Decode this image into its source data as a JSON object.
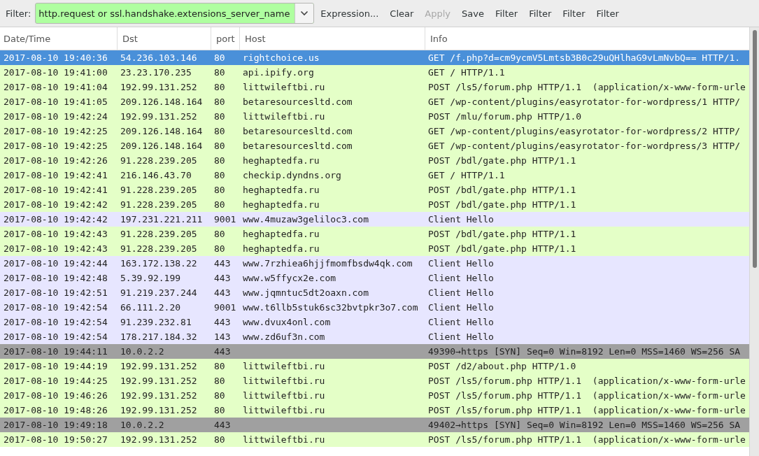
{
  "toolbar": {
    "filter_label": "Filter:",
    "filter_value": "http.request or ssl.handshake.extensions_server_name",
    "buttons": [
      {
        "label": "Expression...",
        "disabled": false
      },
      {
        "label": "Clear",
        "disabled": false
      },
      {
        "label": "Apply",
        "disabled": true
      },
      {
        "label": "Save",
        "disabled": false
      },
      {
        "label": "Filter",
        "disabled": false
      },
      {
        "label": "Filter",
        "disabled": false
      },
      {
        "label": "Filter",
        "disabled": false
      },
      {
        "label": "Filter",
        "disabled": false
      }
    ]
  },
  "table": {
    "columns": [
      "Date/Time",
      "Dst",
      "port",
      "Host",
      "Info"
    ],
    "rows": [
      {
        "cells": [
          "2017-08-10 19:40:36",
          "54.236.103.146",
          "80",
          "rightchoice.us",
          "GET /f.php?d=cm9ycmV5Lmtsb3B0c29uQHlhaG9vLmNvbQ== HTTP/1."
        ],
        "kind": "http",
        "selected": true
      },
      {
        "cells": [
          "2017-08-10 19:41:00",
          "23.23.170.235",
          "80",
          "api.ipify.org",
          "GET / HTTP/1.1"
        ],
        "kind": "http",
        "selected": false
      },
      {
        "cells": [
          "2017-08-10 19:41:04",
          "192.99.131.252",
          "80",
          "littwileftbi.ru",
          "POST /ls5/forum.php HTTP/1.1  (application/x-www-form-urle"
        ],
        "kind": "http",
        "selected": false
      },
      {
        "cells": [
          "2017-08-10 19:41:05",
          "209.126.148.164",
          "80",
          "betaresourcesltd.com",
          "GET /wp-content/plugins/easyrotator-for-wordpress/1 HTTP/"
        ],
        "kind": "http",
        "selected": false
      },
      {
        "cells": [
          "2017-08-10 19:42:24",
          "192.99.131.252",
          "80",
          "littwileftbi.ru",
          "POST /mlu/forum.php HTTP/1.0"
        ],
        "kind": "http",
        "selected": false
      },
      {
        "cells": [
          "2017-08-10 19:42:25",
          "209.126.148.164",
          "80",
          "betaresourcesltd.com",
          "GET /wp-content/plugins/easyrotator-for-wordpress/2 HTTP/"
        ],
        "kind": "http",
        "selected": false
      },
      {
        "cells": [
          "2017-08-10 19:42:25",
          "209.126.148.164",
          "80",
          "betaresourcesltd.com",
          "GET /wp-content/plugins/easyrotator-for-wordpress/3 HTTP/"
        ],
        "kind": "http",
        "selected": false
      },
      {
        "cells": [
          "2017-08-10 19:42:26",
          "91.228.239.205",
          "80",
          "heghaptedfa.ru",
          "POST /bdl/gate.php HTTP/1.1"
        ],
        "kind": "http",
        "selected": false
      },
      {
        "cells": [
          "2017-08-10 19:42:41",
          "216.146.43.70",
          "80",
          "checkip.dyndns.org",
          "GET / HTTP/1.1"
        ],
        "kind": "http",
        "selected": false
      },
      {
        "cells": [
          "2017-08-10 19:42:41",
          "91.228.239.205",
          "80",
          "heghaptedfa.ru",
          "POST /bdl/gate.php HTTP/1.1"
        ],
        "kind": "http",
        "selected": false
      },
      {
        "cells": [
          "2017-08-10 19:42:42",
          "91.228.239.205",
          "80",
          "heghaptedfa.ru",
          "POST /bdl/gate.php HTTP/1.1"
        ],
        "kind": "http",
        "selected": false
      },
      {
        "cells": [
          "2017-08-10 19:42:42",
          "197.231.221.211",
          "9001",
          "www.4muzaw3geliloc3.com",
          "Client Hello"
        ],
        "kind": "tls",
        "selected": false
      },
      {
        "cells": [
          "2017-08-10 19:42:43",
          "91.228.239.205",
          "80",
          "heghaptedfa.ru",
          "POST /bdl/gate.php HTTP/1.1"
        ],
        "kind": "http",
        "selected": false
      },
      {
        "cells": [
          "2017-08-10 19:42:43",
          "91.228.239.205",
          "80",
          "heghaptedfa.ru",
          "POST /bdl/gate.php HTTP/1.1"
        ],
        "kind": "http",
        "selected": false
      },
      {
        "cells": [
          "2017-08-10 19:42:44",
          "163.172.138.22",
          "443",
          "www.7rzhiea6hjjfmomfbsdw4qk.com",
          "Client Hello"
        ],
        "kind": "tls",
        "selected": false
      },
      {
        "cells": [
          "2017-08-10 19:42:48",
          "5.39.92.199",
          "443",
          "www.w5ffycx2e.com",
          "Client Hello"
        ],
        "kind": "tls",
        "selected": false
      },
      {
        "cells": [
          "2017-08-10 19:42:51",
          "91.219.237.244",
          "443",
          "www.jqmntuc5dt2oaxn.com",
          "Client Hello"
        ],
        "kind": "tls",
        "selected": false
      },
      {
        "cells": [
          "2017-08-10 19:42:54",
          "66.111.2.20",
          "9001",
          "www.t6llb5stuk6sc32bvtpkr3o7.com",
          "Client Hello"
        ],
        "kind": "tls",
        "selected": false
      },
      {
        "cells": [
          "2017-08-10 19:42:54",
          "91.239.232.81",
          "443",
          "www.dvux4onl.com",
          "Client Hello"
        ],
        "kind": "tls",
        "selected": false
      },
      {
        "cells": [
          "2017-08-10 19:42:54",
          "178.217.184.32",
          "143",
          "www.zd6uf3n.com",
          "Client Hello"
        ],
        "kind": "tls",
        "selected": false
      },
      {
        "cells": [
          "2017-08-10 19:44:11",
          "10.0.2.2",
          "443",
          "",
          "49390→https [SYN] Seq=0 Win=8192 Len=0 MSS=1460 WS=256 SA"
        ],
        "kind": "tcp",
        "selected": false
      },
      {
        "cells": [
          "2017-08-10 19:44:19",
          "192.99.131.252",
          "80",
          "littwileftbi.ru",
          "POST /d2/about.php HTTP/1.0"
        ],
        "kind": "http",
        "selected": false
      },
      {
        "cells": [
          "2017-08-10 19:44:25",
          "192.99.131.252",
          "80",
          "littwileftbi.ru",
          "POST /ls5/forum.php HTTP/1.1  (application/x-www-form-urle"
        ],
        "kind": "http",
        "selected": false
      },
      {
        "cells": [
          "2017-08-10 19:46:26",
          "192.99.131.252",
          "80",
          "littwileftbi.ru",
          "POST /ls5/forum.php HTTP/1.1  (application/x-www-form-urle"
        ],
        "kind": "http",
        "selected": false
      },
      {
        "cells": [
          "2017-08-10 19:48:26",
          "192.99.131.252",
          "80",
          "littwileftbi.ru",
          "POST /ls5/forum.php HTTP/1.1  (application/x-www-form-urle"
        ],
        "kind": "http",
        "selected": false
      },
      {
        "cells": [
          "2017-08-10 19:49:18",
          "10.0.2.2",
          "443",
          "",
          "49402→https [SYN] Seq=0 Win=8192 Len=0 MSS=1460 WS=256 SA"
        ],
        "kind": "tcp",
        "selected": false
      },
      {
        "cells": [
          "2017-08-10 19:50:27",
          "192.99.131.252",
          "80",
          "littwileftbi.ru",
          "POST /ls5/forum.php HTTP/1.1  (application/x-www-form-urle"
        ],
        "kind": "http",
        "selected": false
      }
    ]
  }
}
